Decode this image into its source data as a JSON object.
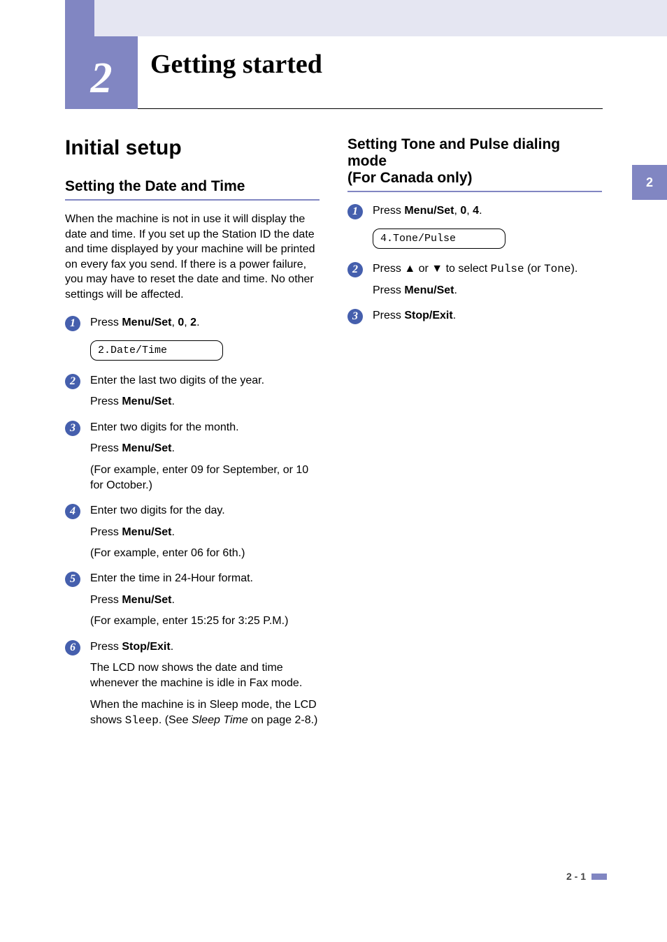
{
  "chapter": {
    "number": "2",
    "title": "Getting started"
  },
  "page_tab": "2",
  "footer": "2 - 1",
  "left": {
    "section": "Initial setup",
    "sub": "Setting the Date and Time",
    "intro": "When the machine is not in use it will display the date and time. If you set up the Station ID the date and time displayed by your machine will be printed on every fax you send. If there is a power failure, you may have to reset the date and time. No other settings will be affected.",
    "steps": {
      "s1": {
        "line_pre": "Press ",
        "b1": "Menu/Set",
        "mid1": ", ",
        "b2": "0",
        "mid2": ", ",
        "b3": "2",
        "end": ".",
        "lcd": "2.Date/Time"
      },
      "s2": {
        "l1": "Enter the last two digits of the year.",
        "l2_pre": "Press ",
        "l2_b": "Menu/Set",
        "l2_end": "."
      },
      "s3": {
        "l1": "Enter two digits for the month.",
        "l2_pre": "Press ",
        "l2_b": "Menu/Set",
        "l2_end": ".",
        "l3": "(For example, enter 09 for September, or 10 for October.)"
      },
      "s4": {
        "l1": "Enter two digits for the day.",
        "l2_pre": "Press ",
        "l2_b": "Menu/Set",
        "l2_end": ".",
        "l3": "(For example, enter 06 for 6th.)"
      },
      "s5": {
        "l1": "Enter the time in 24-Hour format.",
        "l2_pre": "Press ",
        "l2_b": "Menu/Set",
        "l2_end": ".",
        "l3": "(For example, enter 15:25 for 3:25 P.M.)"
      },
      "s6": {
        "l1_pre": "Press ",
        "l1_b": "Stop/Exit",
        "l1_end": ".",
        "l2": "The LCD now shows the date and time whenever the machine is idle in Fax mode.",
        "l3_pre": "When the machine is in Sleep mode, the LCD shows ",
        "l3_mono": "Sleep",
        "l3_mid": ". (See ",
        "l3_italic": "Sleep Time",
        "l3_end": " on page 2-8.)"
      }
    }
  },
  "right": {
    "sub": "Setting Tone and Pulse dialing mode\n(For Canada only)",
    "steps": {
      "s1": {
        "line_pre": "Press ",
        "b1": "Menu/Set",
        "mid1": ", ",
        "b2": "0",
        "mid2": ", ",
        "b3": "4",
        "end": ".",
        "lcd": "4.Tone/Pulse"
      },
      "s2": {
        "l1_pre": "Press ▲ or ▼ to select ",
        "l1_mono1": "Pulse",
        "l1_mid": " (or ",
        "l1_mono2": "Tone",
        "l1_end": ").",
        "l2_pre": "Press ",
        "l2_b": "Menu/Set",
        "l2_end": "."
      },
      "s3": {
        "l1_pre": "Press ",
        "l1_b": "Stop/Exit",
        "l1_end": "."
      }
    }
  }
}
